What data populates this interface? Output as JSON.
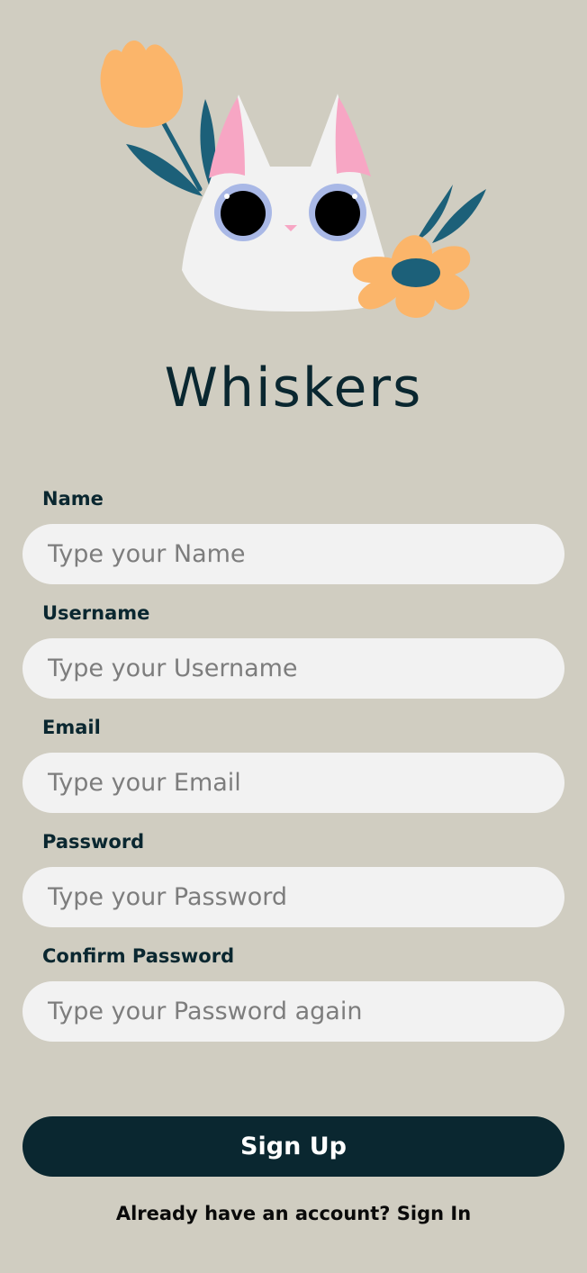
{
  "app": {
    "brand_name": "Whiskers"
  },
  "illustration": {
    "name": "cat-with-flowers-illustration",
    "colors": {
      "background": "#d0cdc1",
      "cat_face": "#f2f2f2",
      "ear_inner": "#f7a6c4",
      "eye_ring": "#a9b8e6",
      "flower": "#fbb56a",
      "leaf": "#1c6079",
      "dark": "#0a2730"
    }
  },
  "form": {
    "fields": [
      {
        "label": "Name",
        "placeholder": "Type your Name"
      },
      {
        "label": "Username",
        "placeholder": "Type your Username"
      },
      {
        "label": "Email",
        "placeholder": "Type your Email"
      },
      {
        "label": "Password",
        "placeholder": "Type your Password"
      },
      {
        "label": "Confirm Password",
        "placeholder": "Type your Password again"
      }
    ],
    "submit_label": "Sign Up"
  },
  "signin": {
    "prompt": "Already have an account?",
    "link_label": "Sign In"
  }
}
